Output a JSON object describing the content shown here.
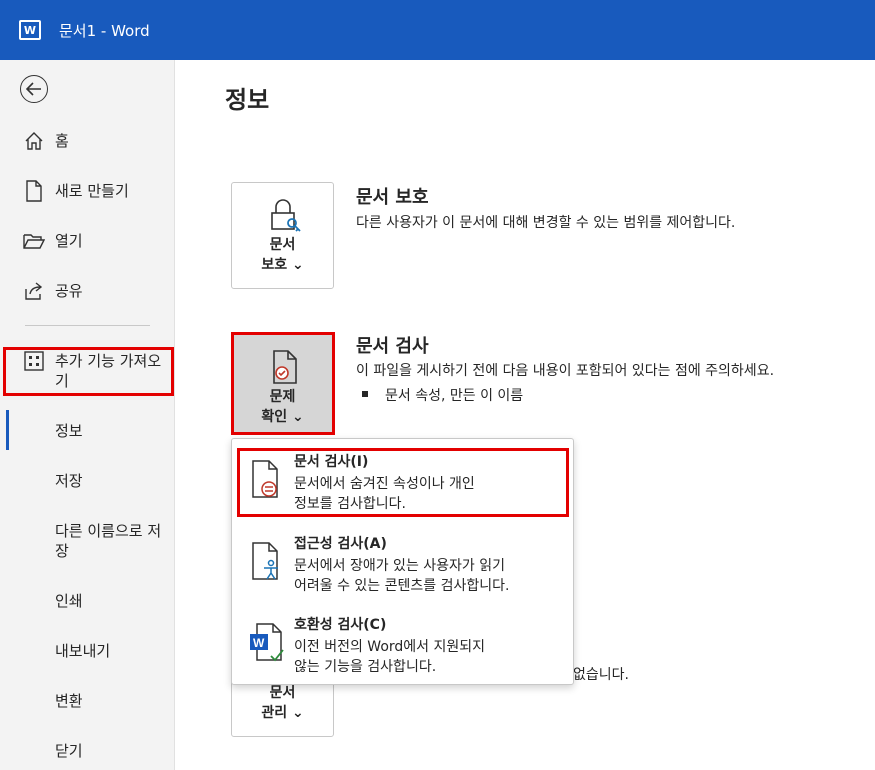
{
  "window": {
    "title": "문서1  -  Word"
  },
  "sidebar": {
    "back_label": "",
    "items": [
      {
        "label": "홈",
        "icon": "home-icon"
      },
      {
        "label": "새로 만들기",
        "icon": "new-document-icon"
      },
      {
        "label": "열기",
        "icon": "folder-open-icon"
      },
      {
        "label": "공유",
        "icon": "share-icon"
      },
      {
        "label": "추가 기능 가져오기",
        "icon": "addins-icon"
      },
      {
        "label": "정보"
      },
      {
        "label": "저장"
      },
      {
        "label": "다른 이름으로 저장"
      },
      {
        "label": "인쇄"
      },
      {
        "label": "내보내기"
      },
      {
        "label": "변환"
      },
      {
        "label": "닫기"
      }
    ],
    "selected": "정보"
  },
  "main": {
    "title": "정보",
    "protect": {
      "card_label_line1": "문서",
      "card_label_line2": "보호 ⌄",
      "title": "문서 보호",
      "desc": "다른 사용자가 이 문서에 대해 변경할 수 있는 범위를 제어합니다."
    },
    "inspect": {
      "card_label_line1": "문제",
      "card_label_line2": "확인 ⌄",
      "title": "문서 검사",
      "desc": "이 파일을 게시하기 전에 다음 내용이 포함되어 있다는 점에 주의하세요.",
      "bullet": "문서 속성, 만든 이 이름"
    },
    "manage": {
      "card_label_line1": "문서",
      "card_label_line2": "관리 ⌄",
      "partial_text": "없습니다."
    }
  },
  "menu": {
    "items": [
      {
        "title": "문서 검사(I)",
        "desc_line1": "문서에서 숨겨진 속성이나 개인",
        "desc_line2": "정보를 검사합니다.",
        "icon": "document-inspect-icon"
      },
      {
        "title": "접근성 검사(A)",
        "desc_line1": "문서에서 장애가 있는 사용자가 읽기",
        "desc_line2": "어려울 수 있는 콘텐츠를 검사합니다.",
        "icon": "accessibility-check-icon"
      },
      {
        "title": "호환성 검사(C)",
        "desc_line1": "이전 버전의 Word에서 지원되지",
        "desc_line2": "않는 기능을 검사합니다.",
        "icon": "compatibility-check-icon"
      }
    ]
  },
  "colors": {
    "titlebar": "#185abd",
    "highlight_red": "#e30000",
    "sidebar_bg": "#f3f3f3"
  }
}
